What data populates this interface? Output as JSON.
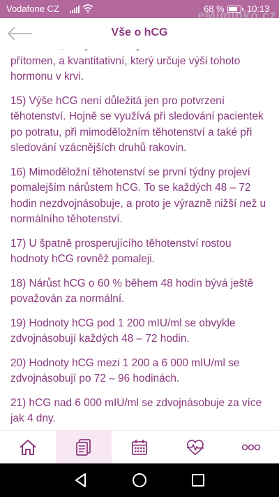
{
  "status_bar": {
    "carrier": "Vodafone CZ",
    "battery_percent": "68 %",
    "battery_level": 0.68,
    "time": "10:13"
  },
  "watermark": "eMiminko.cz",
  "app_bar": {
    "title": "Vše o hCG"
  },
  "content": {
    "paragraphs": [
      "kvalitativní, který říká, zda je tento hormon v krvi přítomen, a kvantitativní, který určuje výši tohoto hormonu v krvi.",
      "15) Výše hCG není důležitá jen pro potvrzení těhotenství. Hojně se využívá při sledování pacientek po potratu, při mimoděložním těhotenství a také při sledování vzácnějších druhů rakovin.",
      "16) Mimoděložní těhotenství se první týdny projeví pomalejším nárůstem hCG. To se každých 48 – 72 hodin nezdvojnásobuje, a proto je výrazně nižší než u normálního těhotenství.",
      "17) U špatně prosperujícího těhotenství rostou hodnoty hCG rovněž pomaleji.",
      "18) Nárůst hCG o 60 % během 48 hodin bývá ještě považován za normální.",
      "19) Hodnoty hCG pod 1 200 mIU/ml se obvykle zdvojnásobují každých 48 – 72 hodin.",
      "20) Hodnoty hCG mezi 1 200 a 6 000 mIU/ml se zdvojnásobují po 72 – 96 hodinách.",
      "21) hCG nad 6 000 mIU/ml se zdvojnásobuje za více jak 4 dny."
    ]
  },
  "bottom_nav": {
    "items": [
      {
        "icon": "home-icon",
        "active": false
      },
      {
        "icon": "articles-icon",
        "active": true
      },
      {
        "icon": "calendar-icon",
        "active": false
      },
      {
        "icon": "heart-pulse-icon",
        "active": false
      },
      {
        "icon": "more-icon",
        "active": false
      }
    ]
  },
  "colors": {
    "accent": "#8d3b81",
    "status_bar": "#b2679d",
    "text": "#8a3a7f",
    "active_tab": "#f8e8f3"
  }
}
